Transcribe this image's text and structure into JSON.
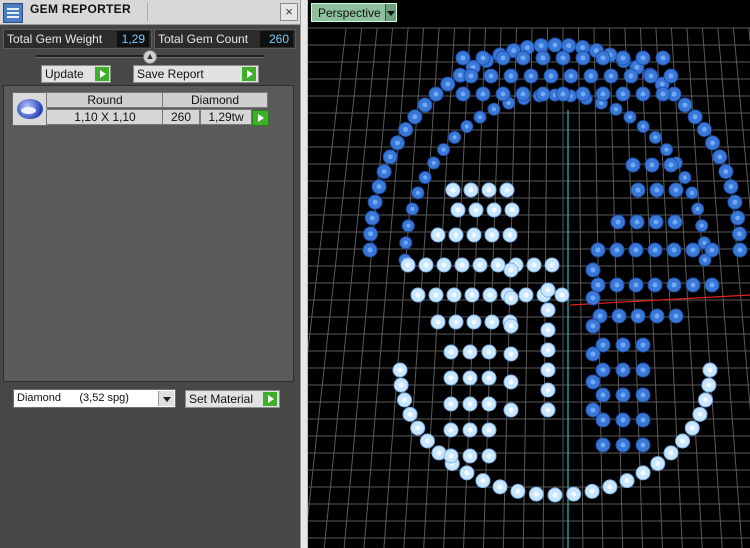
{
  "window": {
    "title": "GEM REPORTER"
  },
  "stats": {
    "weight_label": "Total Gem Weight",
    "weight_value": "1,29",
    "count_label": "Total Gem Count",
    "count_value": "260"
  },
  "toolbar": {
    "update_label": "Update",
    "save_label": "Save Report"
  },
  "gem_list": {
    "rows": [
      {
        "shape": "Round",
        "material": "Diamond",
        "size": "1,10 X 1,10",
        "count": "260",
        "weight": "1,29tw"
      }
    ]
  },
  "material": {
    "selected": "Diamond      (3,52 spg)",
    "set_label": "Set Material"
  },
  "viewport": {
    "mode": "Perspective"
  },
  "colors": {
    "accent_green": "#3fae2a",
    "stat_value": "#7ec8ff",
    "grid_axis_red": "#e02020",
    "grid_axis_cyan": "#20c0c0",
    "gem_blue": "#3a78d8",
    "gem_light": "#c8e6ff"
  },
  "icons": {
    "app": "gem-reporter-icon",
    "close": "close-icon",
    "gem_thumb": "round-gem-icon",
    "play": "arrow-right-icon",
    "dropdown": "chevron-down-icon"
  }
}
